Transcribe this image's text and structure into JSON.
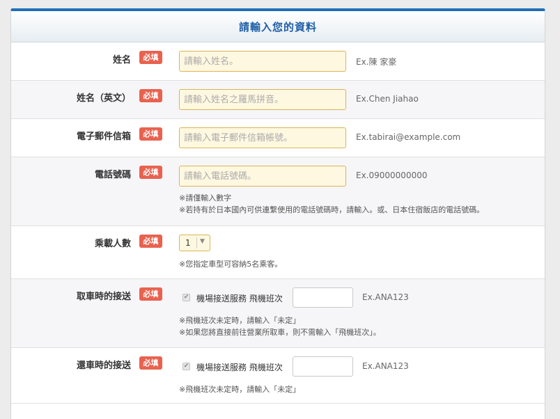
{
  "form": {
    "title": "請輸入您的資料",
    "required_badge": "必填"
  },
  "fields": {
    "name": {
      "label": "姓名",
      "placeholder": "請輸入姓名。",
      "example": "Ex.陳 家豪"
    },
    "name_en": {
      "label": "姓名（英文）",
      "placeholder": "請輸入姓名之羅馬拼音。",
      "example": "Ex.Chen Jiahao"
    },
    "email": {
      "label": "電子郵件信箱",
      "placeholder": "請輸入電子郵件信箱帳號。",
      "example": "Ex.tabirai@example.com"
    },
    "phone": {
      "label": "電話號碼",
      "placeholder": "請輸入電話號碼。",
      "example": "Ex.09000000000",
      "notes": [
        "※請僅輸入數字",
        "※若持有於日本國內可供連繫使用的電話號碼時，請輸入。或、日本住宿飯店的電話號碼。"
      ]
    },
    "passengers": {
      "label": "乘載人數",
      "selected": "1",
      "notes": [
        "※您指定車型可容納5名乘客。"
      ]
    },
    "pickup": {
      "label": "取車時的接送",
      "checkbox_label": "機場接送服務 飛機班次",
      "checked": true,
      "example": "Ex.ANA123",
      "notes": [
        "※飛機班次未定時，請輸入「未定」",
        "※如果您將直接前往營業所取車，則不需輸入「飛機班次」。"
      ]
    },
    "return": {
      "label": "還車時的接送",
      "checkbox_label": "機場接送服務 飛機班次",
      "checked": true,
      "example": "Ex.ANA123",
      "notes": [
        "※飛機班次未定時，請輸入「未定」"
      ]
    }
  },
  "colors": {
    "accent": "#1f6fb8",
    "required_badge": "#e8624f",
    "input_bg": "#fff8e0",
    "input_border": "#d9b456"
  }
}
